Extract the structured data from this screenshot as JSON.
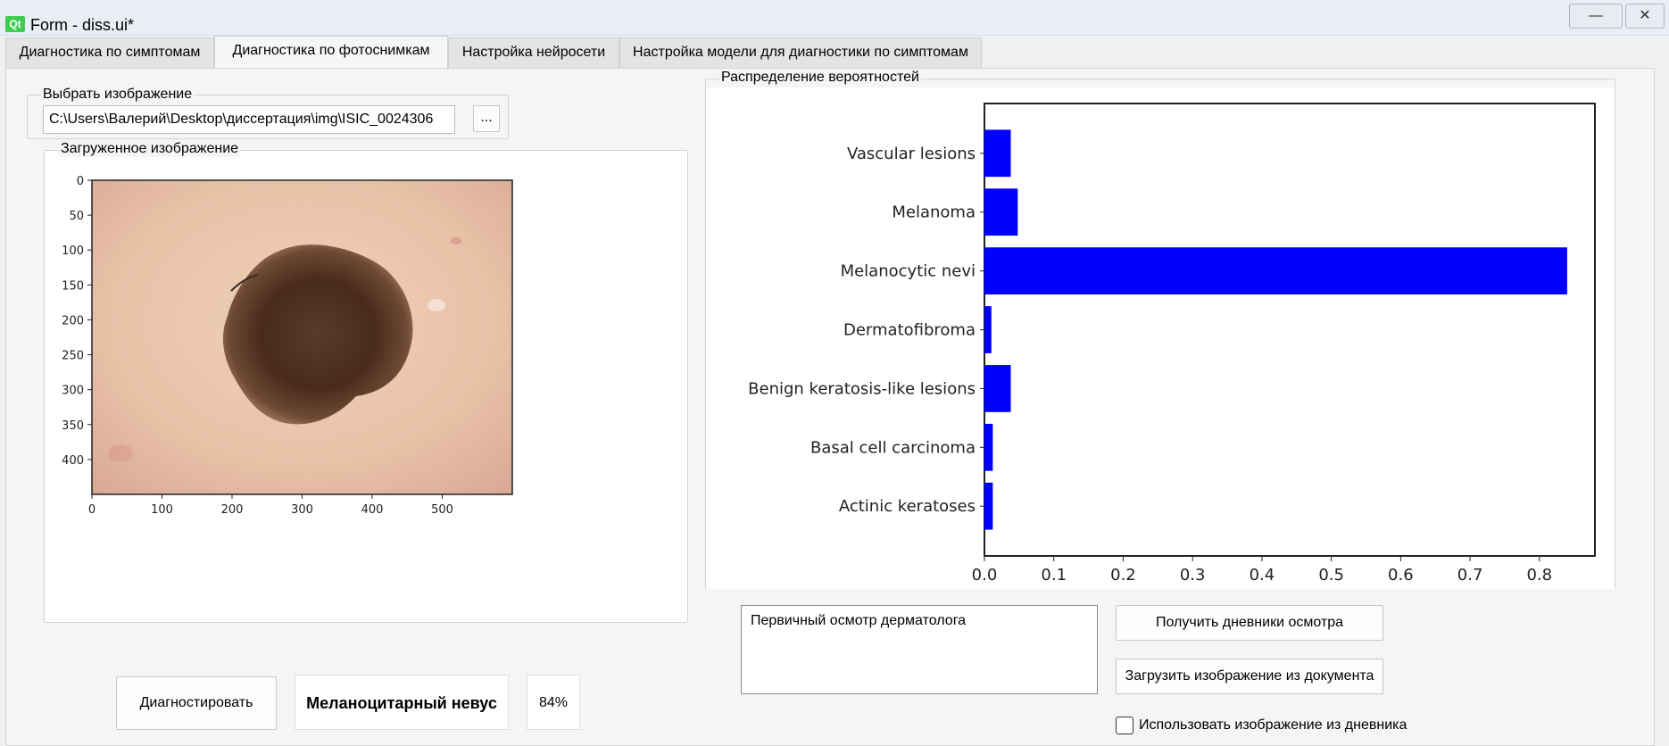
{
  "window": {
    "app_icon_text": "Qt",
    "title": "Form - diss.ui*",
    "minimize_glyph": "—",
    "close_glyph": "✕"
  },
  "tabs": [
    {
      "label": "Диагностика по симптомам",
      "active": false
    },
    {
      "label": "Диагностика по фотоснимкам",
      "active": true
    },
    {
      "label": "Настройка нейросети",
      "active": false
    },
    {
      "label": "Настройка модели для диагностики по симптомам",
      "active": false
    }
  ],
  "select_image": {
    "group_title": "Выбрать изображение",
    "path_value": "C:\\Users\\Валерий\\Desktop\\диссертация\\img\\ISIC_0024306",
    "browse_label": "..."
  },
  "loaded_image": {
    "group_title": "Загруженное изображение",
    "x_ticks": [
      "0",
      "100",
      "200",
      "300",
      "400",
      "500"
    ],
    "y_ticks": [
      "0",
      "50",
      "100",
      "150",
      "200",
      "250",
      "300",
      "350",
      "400"
    ]
  },
  "chart": {
    "group_title": "Распределение вероятностей"
  },
  "chart_data": {
    "type": "bar",
    "orientation": "horizontal",
    "title": "",
    "xlabel": "",
    "ylabel": "",
    "categories": [
      "Actinic keratoses",
      "Basal cell carcinoma",
      "Benign keratosis-like lesions",
      "Dermatofibroma",
      "Melanocytic nevi",
      "Melanoma",
      "Vascular lesions"
    ],
    "values": [
      0.012,
      0.012,
      0.038,
      0.01,
      0.84,
      0.048,
      0.038
    ],
    "x_ticks": [
      "0.0",
      "0.1",
      "0.2",
      "0.3",
      "0.4",
      "0.5",
      "0.6",
      "0.7",
      "0.8"
    ],
    "xlim": [
      0,
      0.88
    ],
    "grid": false,
    "bar_color": "#0000ff"
  },
  "actions": {
    "diagnose_label": "Диагностировать",
    "result_label": "Меланоцитарный невус",
    "confidence": "84%",
    "diary_text": "Первичный осмотр дерматолога",
    "get_diaries_label": "Получить дневники осмотра",
    "load_from_doc_label": "Загрузить изображение из документа",
    "use_diary_image_label": "Использовать изображение из дневника",
    "use_diary_image_checked": false
  }
}
